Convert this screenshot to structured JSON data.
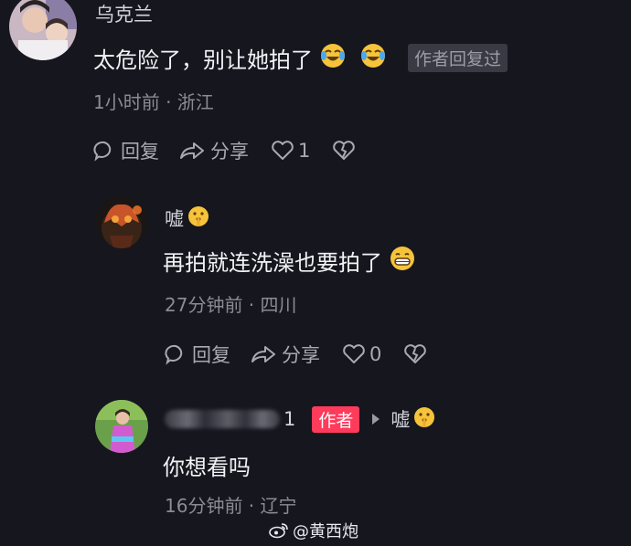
{
  "comments": [
    {
      "username": "乌克兰",
      "text": "太危险了，别让她拍了",
      "emojis": [
        "laughing-tears-emoji",
        "laughing-tears-emoji"
      ],
      "badge": "作者回复过",
      "meta": "1小时前 · 浙江",
      "actions": {
        "reply": "回复",
        "share": "分享",
        "like_count": "1"
      }
    },
    {
      "username": "嘘",
      "username_emoji": "shushing-face-emoji",
      "text": "再拍就连洗澡也要拍了",
      "emojis": [
        "grinning-teeth-emoji"
      ],
      "meta": "27分钟前 · 四川",
      "actions": {
        "reply": "回复",
        "share": "分享",
        "like_count": "0"
      }
    },
    {
      "username": "1",
      "author_badge": "作者",
      "reply_to": "嘘",
      "reply_to_emoji": "shushing-face-emoji",
      "text": "你想看吗",
      "meta": "16分钟前 · 辽宁"
    }
  ],
  "watermark": {
    "text": "@黄西炮",
    "icon": "weibo-icon"
  }
}
